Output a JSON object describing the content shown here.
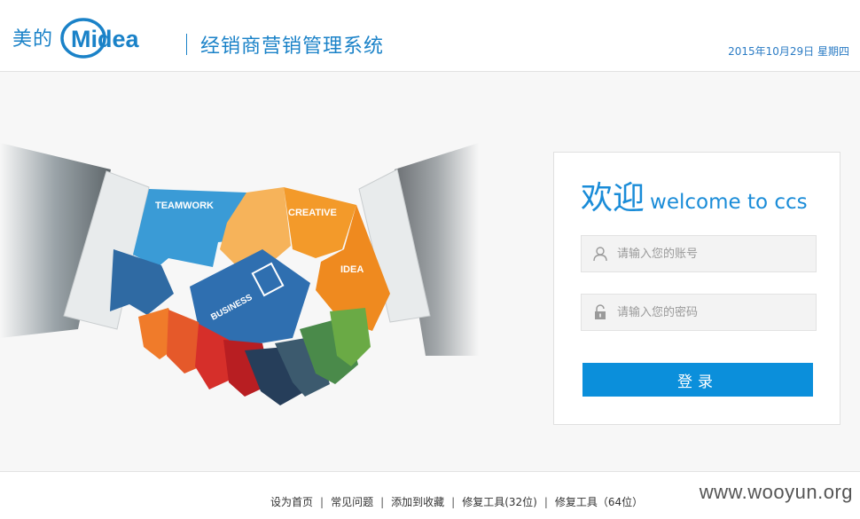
{
  "header": {
    "brand_cn": "美的",
    "brand_en": "Midea",
    "system_title": "经销商营销管理系统",
    "date": "2015年10月29日 星期四"
  },
  "hero": {
    "puzzle_labels": {
      "teamwork": "TEAMWORK",
      "creative": "CREATIVE",
      "idea": "IDEA",
      "business": "BUSINESS"
    }
  },
  "login": {
    "welcome_cn": "欢迎",
    "welcome_en": "welcome to ccs",
    "username_placeholder": "请输入您的账号",
    "password_placeholder": "请输入您的密码",
    "submit_label": "登录"
  },
  "footer": {
    "links": [
      "设为首页",
      "常见问题",
      "添加到收藏",
      "修复工具(32位)",
      "修复工具（64位）"
    ],
    "watermark": "www.wooyun.org"
  },
  "colors": {
    "brand_blue": "#1a82c8",
    "button_blue": "#0b8fdb",
    "teamwork": "#3a9bd6",
    "creative": "#f39a2a",
    "idea": "#ef8a1f",
    "business": "#2f6fb0"
  }
}
